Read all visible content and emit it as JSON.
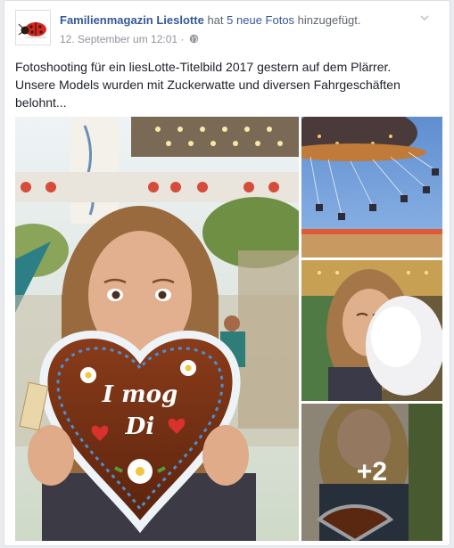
{
  "post": {
    "page_name": "Familienmagazin Lieslotte",
    "action_pre": "hat",
    "action_link": "5 neue Fotos",
    "action_post": "hinzugefügt.",
    "timestamp": "12. September um 12:01",
    "separator": "·",
    "privacy_icon": "globe-icon",
    "avatar_icon": "ladybug-logo",
    "text_lines": [
      "Fotoshooting für ein liesLotte-Titelbild 2017 gestern auf dem Plärrer.",
      "Unsere Models wurden mit Zuckerwatte und diversen Fahrgeschäften",
      "belohnt..."
    ]
  },
  "photos": {
    "main": {
      "lettering": "I mog Di"
    },
    "more_count": "+2"
  },
  "colors": {
    "link": "#365899",
    "meta": "#90949c",
    "text": "#1d2129"
  }
}
